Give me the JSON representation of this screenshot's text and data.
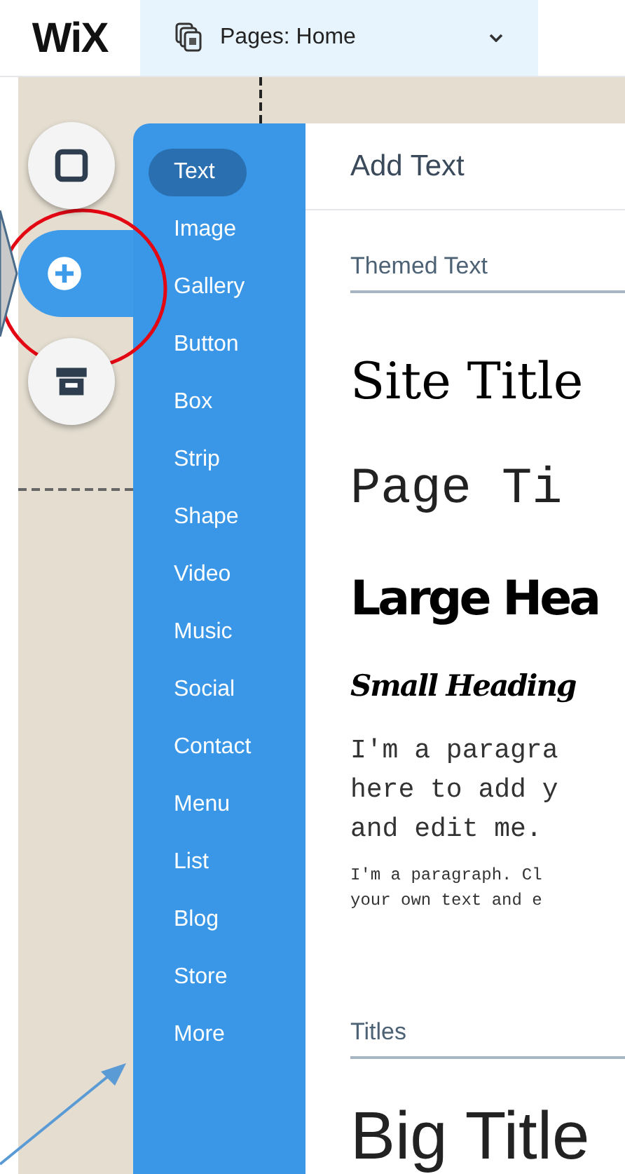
{
  "top_bar": {
    "logo": "WiX",
    "pages_dropdown": {
      "label": "Pages: Home"
    }
  },
  "tool_rail": [
    {
      "kind": "square",
      "selected": false
    },
    {
      "kind": "plus",
      "selected": true
    },
    {
      "kind": "store",
      "selected": false
    }
  ],
  "add_menu": [
    {
      "label": "Text",
      "selected": true
    },
    {
      "label": "Image",
      "selected": false
    },
    {
      "label": "Gallery",
      "selected": false
    },
    {
      "label": "Button",
      "selected": false
    },
    {
      "label": "Box",
      "selected": false
    },
    {
      "label": "Strip",
      "selected": false
    },
    {
      "label": "Shape",
      "selected": false
    },
    {
      "label": "Video",
      "selected": false
    },
    {
      "label": "Music",
      "selected": false
    },
    {
      "label": "Social",
      "selected": false
    },
    {
      "label": "Contact",
      "selected": false
    },
    {
      "label": "Menu",
      "selected": false
    },
    {
      "label": "List",
      "selected": false
    },
    {
      "label": "Blog",
      "selected": false
    },
    {
      "label": "Store",
      "selected": false
    },
    {
      "label": "More",
      "selected": false
    }
  ],
  "panel": {
    "title": "Add Text",
    "sections": [
      {
        "heading": "Themed Text",
        "samples": [
          {
            "kind": "site_title",
            "lines": [
              "Site Title"
            ]
          },
          {
            "kind": "page_title",
            "lines": [
              "Page Ti"
            ]
          },
          {
            "kind": "large_heading",
            "lines": [
              "Large Hea"
            ]
          },
          {
            "kind": "small_heading",
            "lines": [
              "Small Heading"
            ]
          },
          {
            "kind": "paragraph",
            "lines": [
              "I'm a paragra",
              "here to add y",
              "and edit me."
            ]
          },
          {
            "kind": "small_paragraph",
            "lines": [
              "I'm a paragraph. Cl",
              "your own text and e"
            ]
          }
        ]
      },
      {
        "heading": "Titles",
        "samples": [
          {
            "kind": "big_title",
            "lines": [
              "Big Title"
            ]
          }
        ]
      }
    ]
  }
}
